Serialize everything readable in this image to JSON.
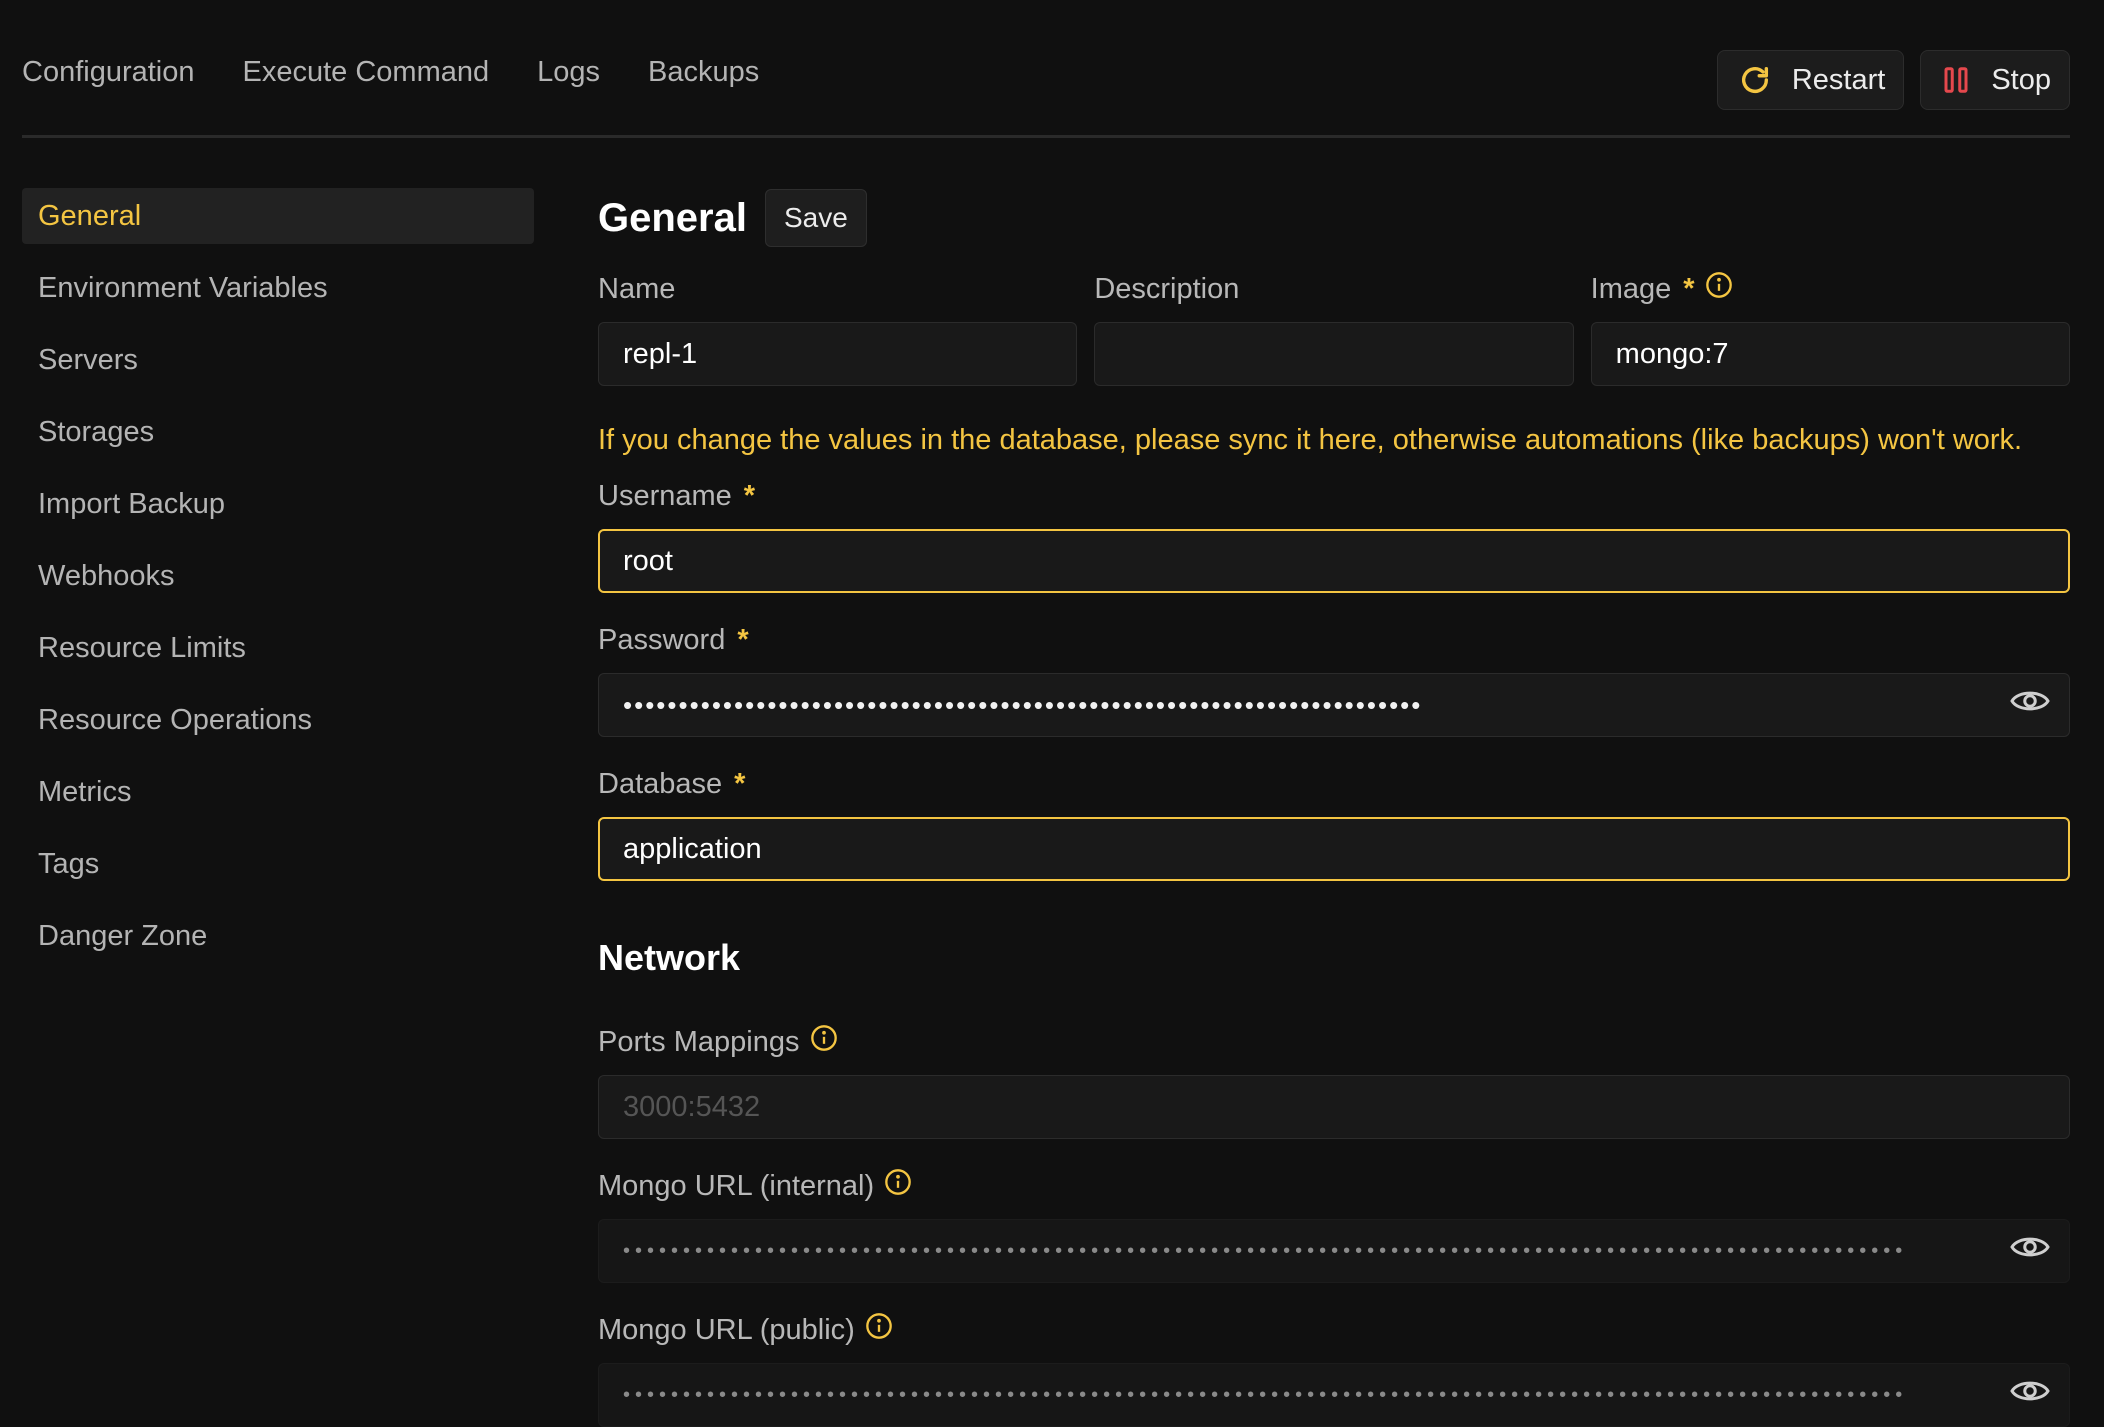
{
  "tabs": [
    "Configuration",
    "Execute Command",
    "Logs",
    "Backups"
  ],
  "actions": {
    "restart_label": "Restart",
    "stop_label": "Stop"
  },
  "sidebar": {
    "active": "General",
    "items": [
      "General",
      "Environment Variables",
      "Servers",
      "Storages",
      "Import Backup",
      "Webhooks",
      "Resource Limits",
      "Resource Operations",
      "Metrics",
      "Tags",
      "Danger Zone"
    ]
  },
  "general": {
    "title": "General",
    "save_label": "Save",
    "name_label": "Name",
    "name_value": "repl-1",
    "description_label": "Description",
    "description_value": "",
    "image_label": "Image",
    "image_value": "mongo:7",
    "warning": "If you change the values in the database, please sync it here, otherwise automations (like backups) won't work.",
    "username_label": "Username",
    "username_value": "root",
    "password_label": "Password",
    "password_masked": "••••••••••••••••••••••••••••••••••••••••••••••••••••••••••••••••••••••••",
    "database_label": "Database",
    "database_value": "application"
  },
  "network": {
    "title": "Network",
    "ports_label": "Ports Mappings",
    "ports_placeholder": "3000:5432",
    "mongo_internal_label": "Mongo URL (internal)",
    "mongo_internal_masked": "•••••••••••••••••••••••••••••••••••••••••••••••••••••••••••••••••••••••••••••••••••••••••••••••••••••••••••",
    "mongo_public_label": "Mongo URL (public)",
    "mongo_public_masked": "•••••••••••••••••••••••••••••••••••••••••••••••••••••••••••••••••••••••••••••••••••••••••••••••••••••••••••"
  },
  "required_marker": "*",
  "colors": {
    "accent": "#f4c542",
    "stop": "#e5484d",
    "background": "#101010"
  }
}
